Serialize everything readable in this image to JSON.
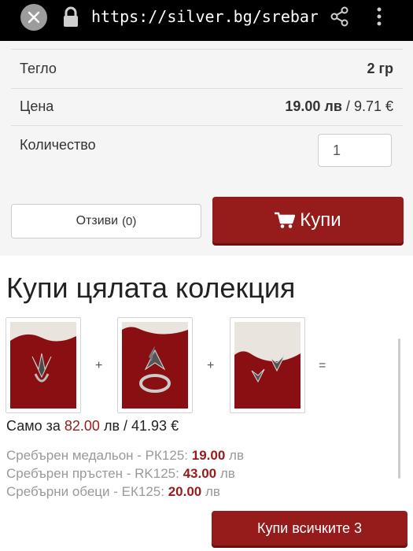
{
  "browser": {
    "url": "https://silver.bg/srebaren-me",
    "icons": {
      "close": "close-icon",
      "lock": "lock-icon",
      "share": "share-icon",
      "menu": "more-vert-icon"
    }
  },
  "specs": {
    "weight_label": "Тегло",
    "weight_value": "2 гр",
    "price_label": "Цена",
    "price_main": "19.00 лв",
    "price_separator": "/",
    "price_eur": "9.71 €",
    "quantity_label": "Количество",
    "quantity_value": "1"
  },
  "actions": {
    "reviews_label": "Отзиви",
    "reviews_count": "(0)",
    "buy_label": "Купи",
    "buy_icon": "cart-icon"
  },
  "collection": {
    "title": "Купи цялата колекция",
    "plus": "+",
    "equals": "=",
    "total_prefix": "Само за",
    "total_price": "82.00",
    "total_suffix": "лв / 41.93 €",
    "items": [
      {
        "name": "Сребърен медальон - РК125:",
        "price": "19.00",
        "currency": "лв"
      },
      {
        "name": "Сребърен пръстен - RK125:",
        "price": "43.00",
        "currency": "лв"
      },
      {
        "name": "Сребърни обеци - ЕК125:",
        "price": "20.00",
        "currency": "лв"
      }
    ],
    "buy_all_label": "Купи всичките 3"
  },
  "colors": {
    "accent": "#961b1b",
    "panel": "#f5f5f5",
    "toolbar": "#000000"
  }
}
